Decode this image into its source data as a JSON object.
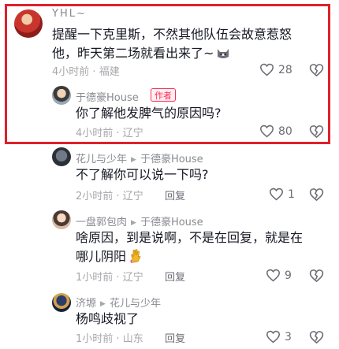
{
  "comments": [
    {
      "username": "YHL~",
      "text_line1": "提醒一下克里斯，不然其他队伍会故意惹怒",
      "text_line2": "他，昨天第二场就看出来了~",
      "time": "4小时前",
      "location": "福建",
      "likes": "28",
      "emoji_icon": "cat-emoji-icon",
      "reply": {
        "username": "于德豪House",
        "author_badge": "作者",
        "text": "你了解他发脾气的原因吗?",
        "time": "4小时前",
        "location": "辽宁",
        "likes": "80"
      }
    },
    {
      "username": "花儿与少年",
      "reply_to": "于德豪House",
      "text": "不了解你可以说一下吗?",
      "time": "2小时前",
      "location": "辽宁",
      "reply_label": "回复",
      "likes": "1"
    },
    {
      "username": "一盘郭包肉",
      "reply_to": "于德豪House",
      "text_line1": "啥原因，到是说啊，不是在回复，就是在",
      "text_line2": "哪儿阴阳",
      "emoji_icon": "gold-hand-emoji-icon",
      "time": "1小时前",
      "location": "辽宁",
      "reply_label": "回复",
      "likes": "9"
    },
    {
      "username": "济塬",
      "reply_to": "花儿与少年",
      "text": "杨鸣歧视了",
      "time": "1小时前",
      "location": "山东",
      "reply_label": "回复",
      "likes": "3"
    }
  ],
  "separator": "·",
  "colors": {
    "highlight": "#e0202a",
    "author_tag": "#fe2c55",
    "muted": "#a6a7ab"
  }
}
